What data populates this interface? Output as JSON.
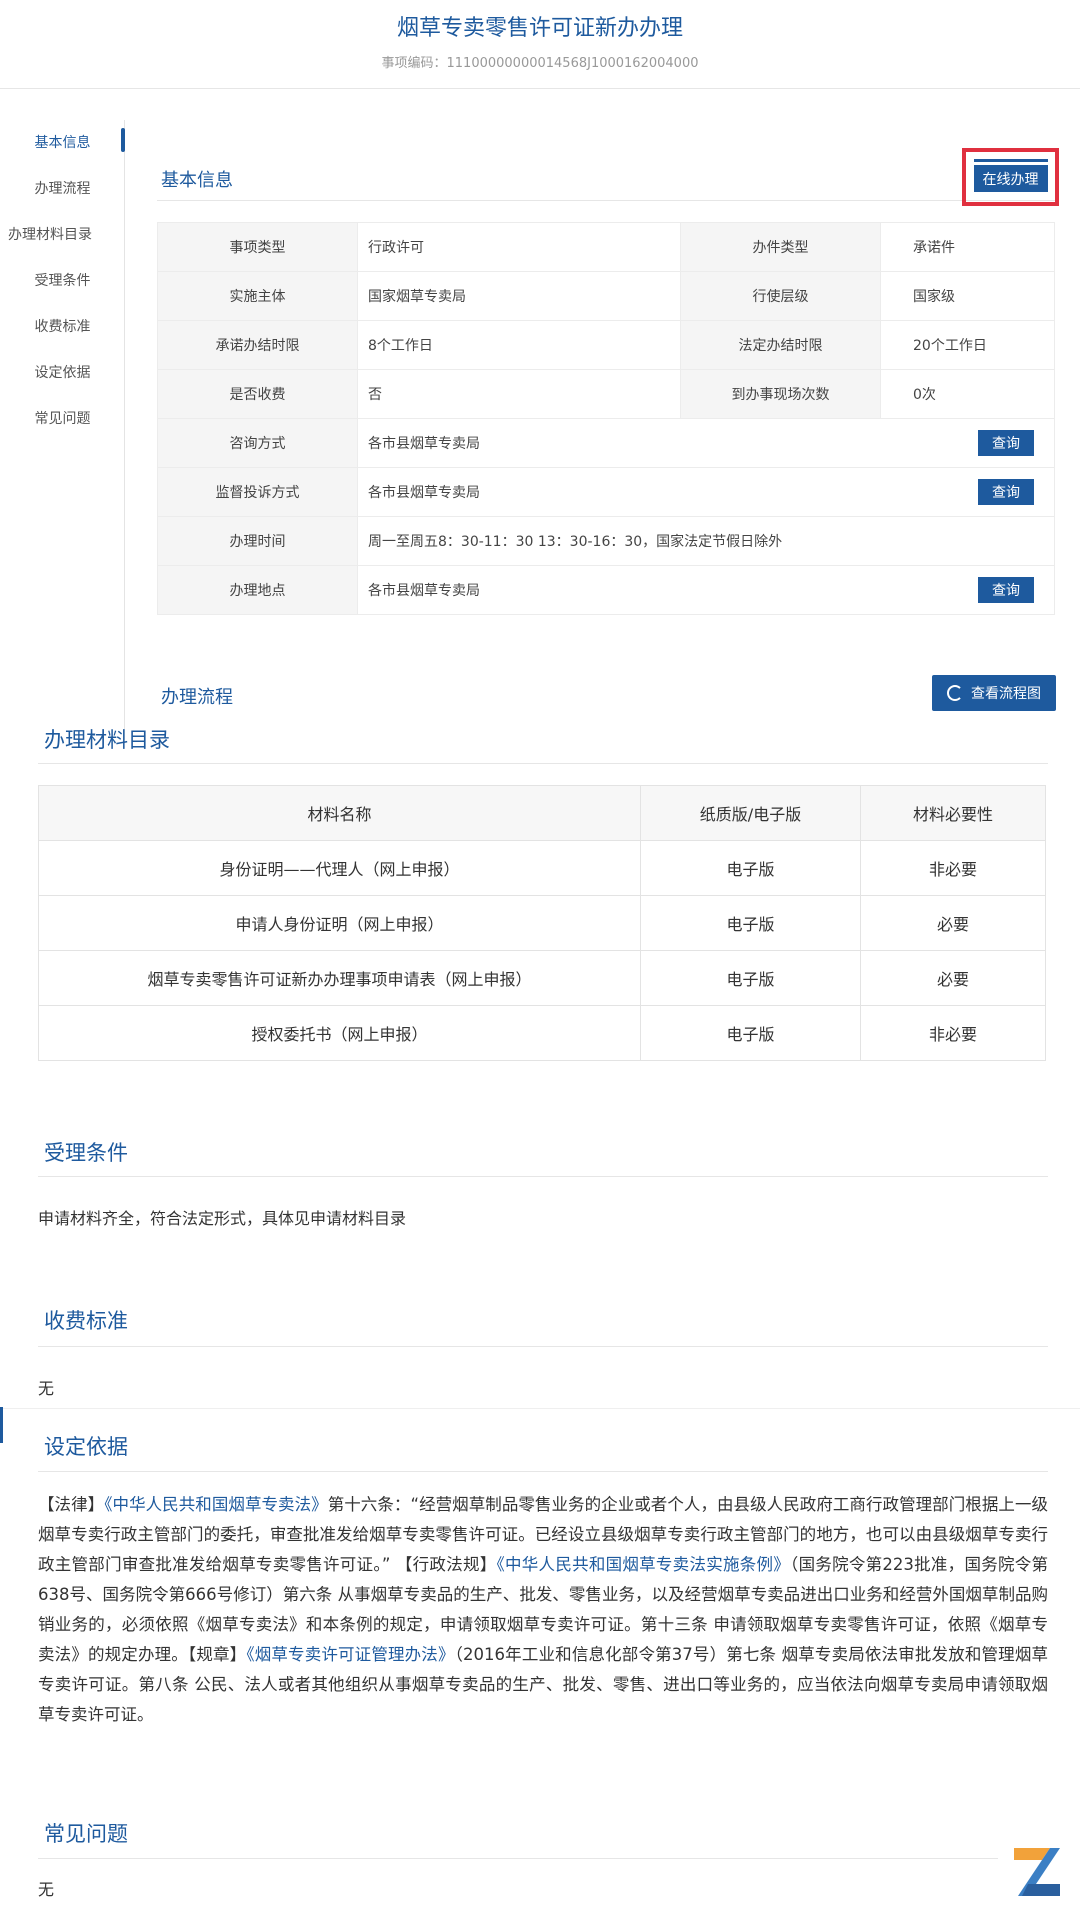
{
  "header": {
    "title": "烟草专卖零售许可证新办办理",
    "code": "事项编码：11100000000014568J1000162004000"
  },
  "sidenav": {
    "items": [
      "基本信息",
      "办理流程",
      "办理材料目录",
      "受理条件",
      "收费标准",
      "设定依据",
      "常见问题"
    ]
  },
  "basic": {
    "title": "基本信息",
    "online_button": "在线办理",
    "rows": [
      {
        "l1": "事项类型",
        "v1": "行政许可",
        "l2": "办件类型",
        "v2": "承诺件"
      },
      {
        "l1": "实施主体",
        "v1": "国家烟草专卖局",
        "l2": "行使层级",
        "v2": "国家级"
      },
      {
        "l1": "承诺办结时限",
        "v1": "8个工作日",
        "l2": "法定办结时限",
        "v2": "20个工作日"
      },
      {
        "l1": "是否收费",
        "v1": "否",
        "l2": "到办事现场次数",
        "v2": "0次"
      }
    ],
    "full_rows": [
      {
        "label": "咨询方式",
        "value": "各市县烟草专卖局",
        "button": "查询"
      },
      {
        "label": "监督投诉方式",
        "value": "各市县烟草专卖局",
        "button": "查询"
      },
      {
        "label": "办理时间",
        "value": "周一至周五8：30-11：30 13：30-16：30，国家法定节假日除外",
        "button": ""
      },
      {
        "label": "办理地点",
        "value": "各市县烟草专卖局",
        "button": "查询"
      }
    ]
  },
  "flow": {
    "title": "办理流程",
    "button": "查看流程图"
  },
  "materials": {
    "title": "办理材料目录",
    "headers": [
      "材料名称",
      "纸质版/电子版",
      "材料必要性"
    ],
    "rows": [
      [
        "身份证明——代理人（网上申报）",
        "电子版",
        "非必要"
      ],
      [
        "申请人身份证明（网上申报）",
        "电子版",
        "必要"
      ],
      [
        "烟草专卖零售许可证新办办理事项申请表（网上申报）",
        "电子版",
        "必要"
      ],
      [
        "授权委托书（网上申报）",
        "电子版",
        "非必要"
      ]
    ]
  },
  "conditions": {
    "title": "受理条件",
    "text": "申请材料齐全，符合法定形式，具体见申请材料目录"
  },
  "fees": {
    "title": "收费标准",
    "text": "无"
  },
  "basis": {
    "title": "设定依据",
    "p1": "【法律】",
    "law1": "《中华人民共和国烟草专卖法》",
    "p2": "第十六条：“经营烟草制品零售业务的企业或者个人，由县级人民政府工商行政管理部门根据上一级烟草专卖行政主管部门的委托，审查批准发给烟草专卖零售许可证。已经设立县级烟草专卖行政主管部门的地方，也可以由县级烟草专卖行政主管部门审查批准发给烟草专卖零售许可证。” 【行政法规】",
    "law2": "《中华人民共和国烟草专卖法实施条例》",
    "p3": "（国务院令第223批准，国务院令第638号、国务院令第666号修订）第六条 从事烟草专卖品的生产、批发、零售业务，以及经营烟草专卖品进出口业务和经营外国烟草制品购销业务的，必须依照《烟草专卖法》和本条例的规定，申请领取烟草专卖许可证。第十三条 申请领取烟草专卖零售许可证，依照《烟草专卖法》的规定办理。【规章】",
    "law3": "《烟草专卖许可证管理办法》",
    "p4": "（2016年工业和信息化部令第37号）第七条 烟草专卖局依法审批发放和管理烟草专卖许可证。第八条 公民、法人或者其他组织从事烟草专卖品的生产、批发、零售、进出口等业务的，应当依法向烟草专卖局申请领取烟草专卖许可证。"
  },
  "faq": {
    "title": "常见问题",
    "text": "无"
  },
  "colors": {
    "accent": "#1e5a9e",
    "highlight": "#e0303f"
  }
}
